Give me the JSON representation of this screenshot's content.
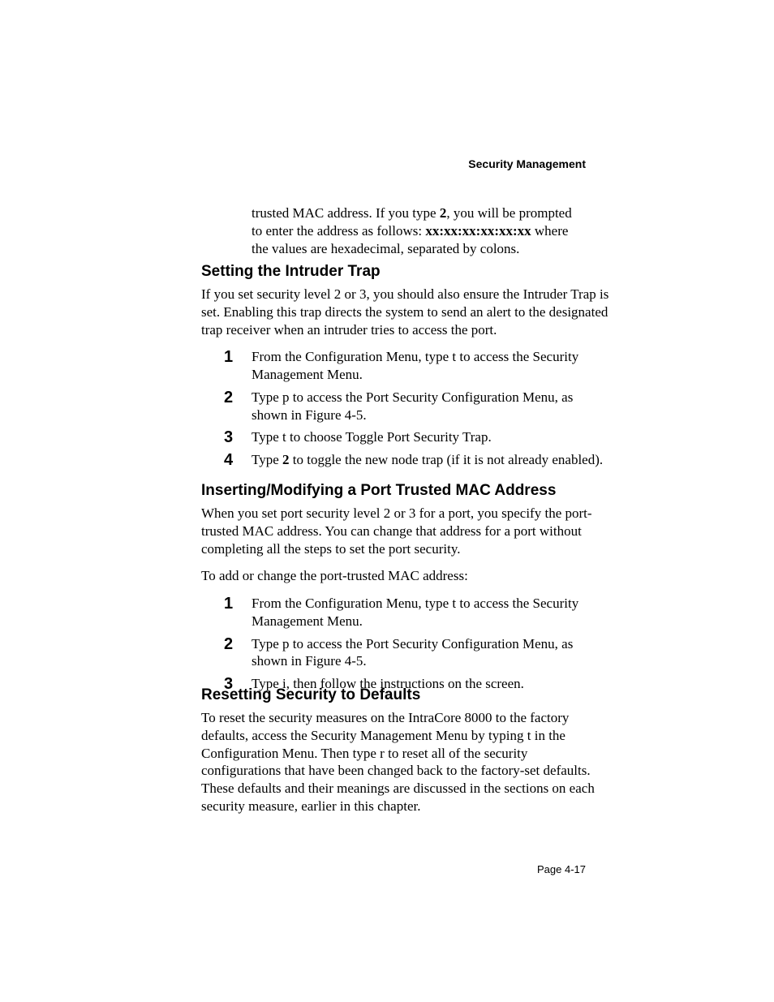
{
  "header": {
    "title": "Security Management"
  },
  "intro": {
    "pre": "trusted MAC address. If you type ",
    "bold1": "2",
    "mid": ", you will be prompted to enter the address as follows: ",
    "bold2": "xx:xx:xx:xx:xx:xx",
    "post": " where the values are hexadecimal, separated by colons."
  },
  "sec1": {
    "title": "Setting the Intruder Trap",
    "para": "If you set security level 2 or 3, you should also ensure the Intruder Trap is set. Enabling this trap directs the system to send an alert to the designated trap receiver when an intruder tries to access the port.",
    "steps": {
      "n1": "1",
      "t1": "From the Configuration Menu, type t to access the Security Management Menu.",
      "n2": "2",
      "t2": "Type p to access the Port Security Configuration Menu, as shown in Figure 4-5.",
      "n3": "3",
      "t3": "Type t to choose Toggle Port Security Trap.",
      "n4": "4",
      "t4_pre": "Type ",
      "t4_b": "2",
      "t4_post": " to toggle the new node trap (if it is not already enabled)."
    }
  },
  "sec2": {
    "title": "Inserting/Modifying a Port Trusted MAC Address",
    "para1": "When you set port security level 2 or 3 for a port, you specify the port-trusted MAC address. You can change that address for a port without completing all the steps to set the port security.",
    "para2": "To add or change the port-trusted MAC address:",
    "steps": {
      "n1": "1",
      "t1": "From the Configuration Menu, type t to access the Security Management Menu.",
      "n2": "2",
      "t2": "Type p to access the Port Security Configuration Menu, as shown in Figure 4-5.",
      "n3": "3",
      "t3": "Type i, then follow the instructions on the screen."
    }
  },
  "sec3": {
    "title": "Resetting Security to Defaults",
    "para": "To reset the security measures on the IntraCore 8000 to the factory defaults, access the Security Management Menu by typing t in the Configuration Menu. Then type r to reset all of the security configurations that have been changed back to the factory-set defaults. These defaults and their meanings are discussed in the sections on each security measure, earlier in this chapter."
  },
  "footer": {
    "page": "Page 4-17"
  }
}
